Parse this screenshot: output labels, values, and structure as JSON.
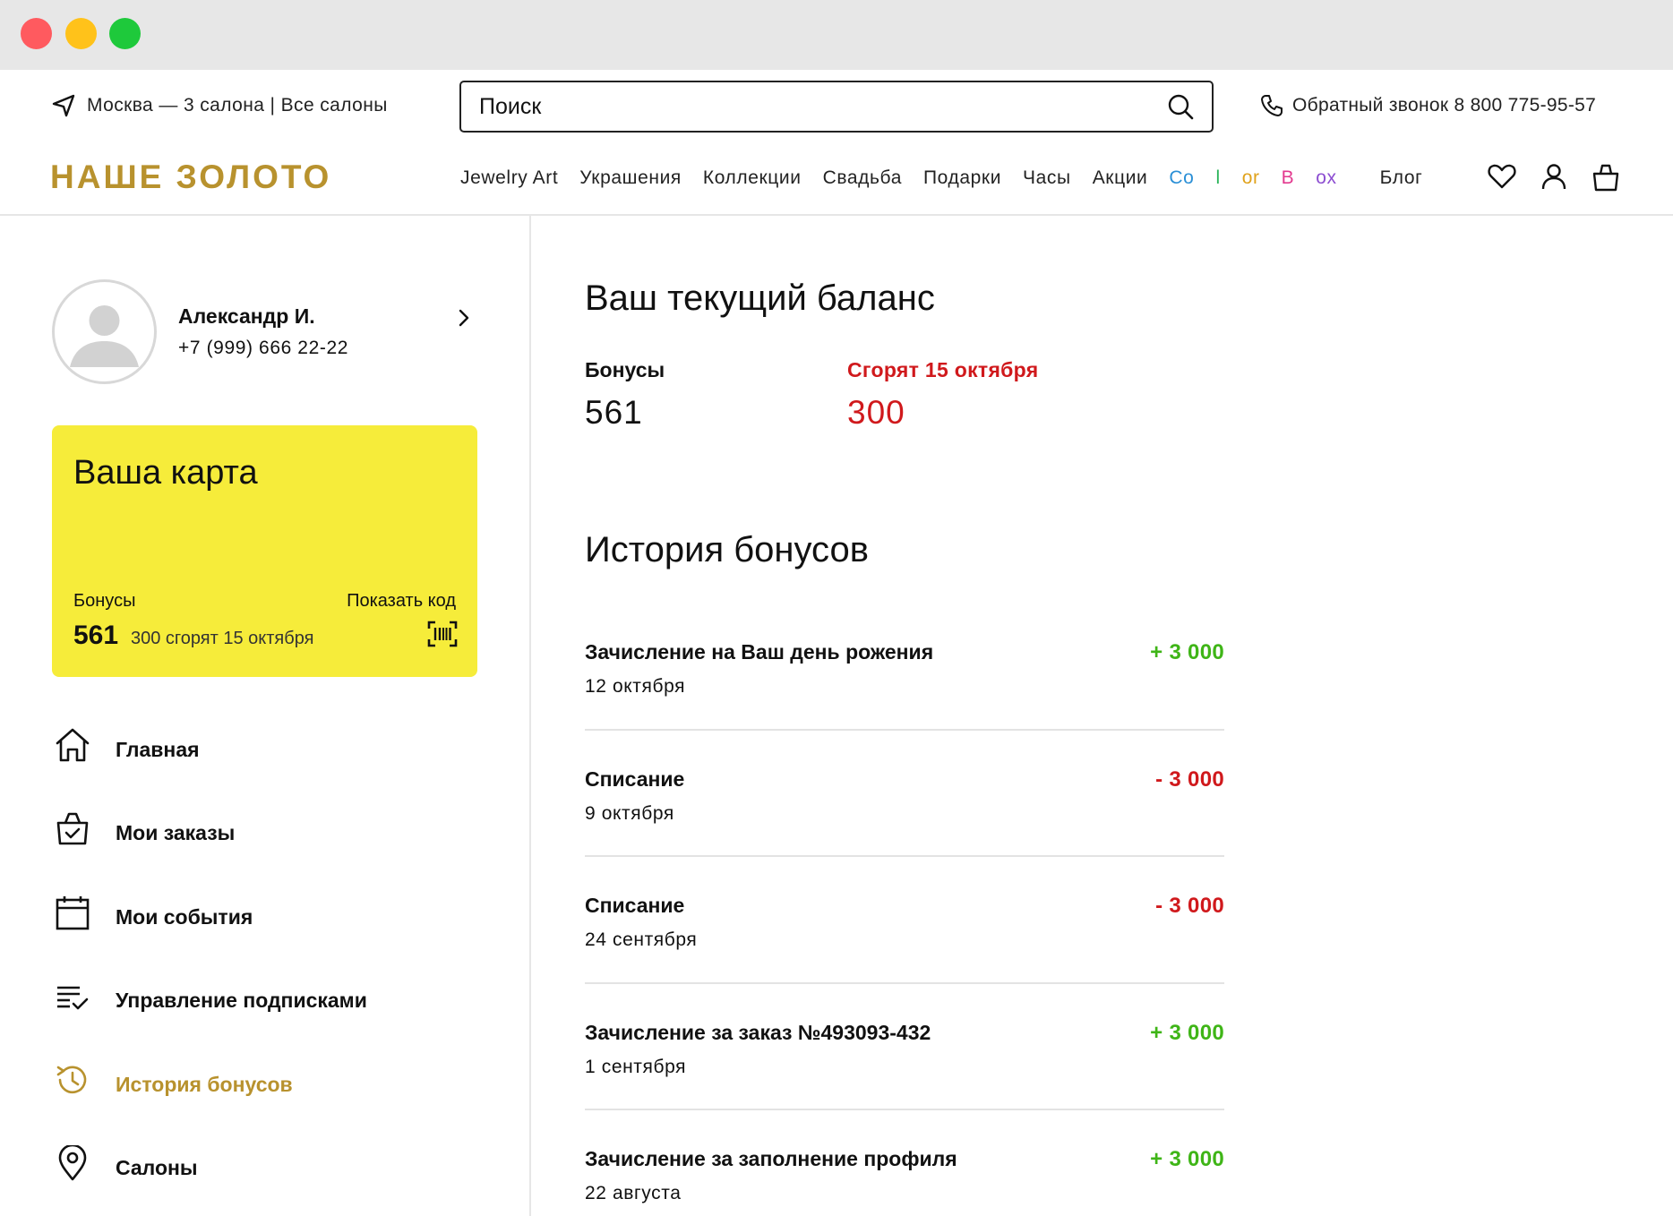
{
  "header": {
    "location_city": "Москва — 3 салона",
    "location_all": "Все салоны",
    "search_placeholder": "Поиск",
    "callback": "Обратный звонок 8 800 775-95-57",
    "logo": "НАШЕ ЗОЛОТО",
    "nav": [
      "Jewelry Art",
      "Украшения",
      "Коллекции",
      "Свадьба",
      "Подарки",
      "Часы",
      "Акции",
      "ColorBox",
      "Блог"
    ],
    "colorbox_letters": [
      "Co",
      "l",
      "or",
      "B",
      "ox"
    ],
    "icons": [
      "heart-icon",
      "user-icon",
      "bag-icon"
    ]
  },
  "profile": {
    "name": "Александр И.",
    "phone": "+7 (999) 666 22-22"
  },
  "card": {
    "title": "Ваша карта",
    "bonus_label": "Бонусы",
    "show_code": "Показать код",
    "bonus_value": "561",
    "expire_text": "300 сгорят 15 октября",
    "background": "#f6ec3a"
  },
  "menu": [
    {
      "label": "Главная",
      "icon": "home-icon"
    },
    {
      "label": "Мои заказы",
      "icon": "shopping-bag-check-icon"
    },
    {
      "label": "Мои события",
      "icon": "calendar-icon"
    },
    {
      "label": "Управление подписками",
      "icon": "list-check-icon"
    },
    {
      "label": "История бонусов",
      "icon": "history-icon",
      "active": true
    },
    {
      "label": "Салоны",
      "icon": "map-pin-icon"
    }
  ],
  "balance": {
    "title": "Ваш текущий баланс",
    "bonus_label": "Бонусы",
    "bonus_value": "561",
    "expire_label": "Сгорят 15 октября",
    "expire_value": "300"
  },
  "history": {
    "title": "История бонусов",
    "items": [
      {
        "title": "Зачисление на Ваш день рожения",
        "date": "12 октября",
        "amount": "+ 3 000",
        "type": "plus"
      },
      {
        "title": "Списание",
        "date": "9 октября",
        "amount": "- 3 000",
        "type": "minus"
      },
      {
        "title": "Списание",
        "date": "24 сентября",
        "amount": "- 3 000",
        "type": "minus"
      },
      {
        "title": "Зачисление за заказ №493093-432",
        "date": "1 сентября",
        "amount": "+ 3 000",
        "type": "plus"
      },
      {
        "title": "Зачисление за заполнение профиля",
        "date": "22 августа",
        "amount": "+ 3 000",
        "type": "plus"
      }
    ]
  },
  "colors": {
    "gold": "#b8922e",
    "red": "#d0191c",
    "green": "#3fb517"
  }
}
